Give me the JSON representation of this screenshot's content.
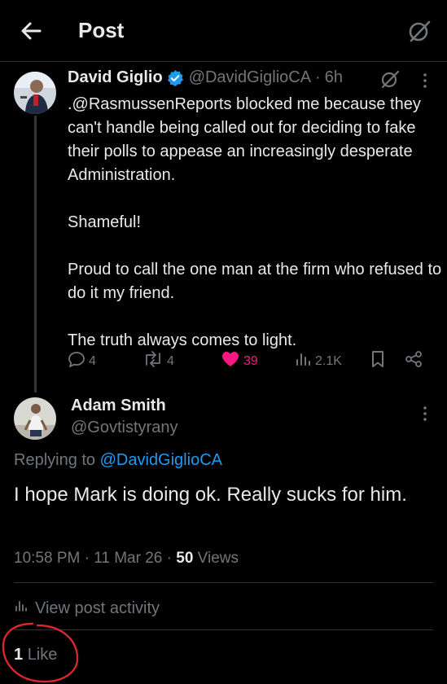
{
  "header": {
    "title": "Post"
  },
  "parent_post": {
    "author_name": "David Giglio",
    "handle": "@DavidGiglioCA",
    "separator": "·",
    "time": "6h",
    "paragraphs": [
      ".@RasmussenReports blocked me because they can't handle being called out for deciding to fake their polls to appease an increasingly desperate Administration.",
      "Shameful!",
      "Proud to call the one man at the firm who refused to do it my friend.",
      "The truth always comes to light."
    ],
    "actions": {
      "replies": "4",
      "reposts": "4",
      "likes": "39",
      "views": "2.1K"
    },
    "colors": {
      "like": "#f91880",
      "verified": "#1d9bf0"
    }
  },
  "reply": {
    "author_name": "Adam Smith",
    "handle": "@Govtistyrany",
    "replying_prefix": "Replying to",
    "replying_to": "@DavidGiglioCA",
    "text": "I hope Mark is doing ok. Really sucks for him.",
    "time": "10:58 PM",
    "sep1": "·",
    "date": "11 Mar 26",
    "sep2": "·",
    "views_count": "50",
    "views_label": "Views",
    "activity_label": "View post activity",
    "likes_count": "1",
    "likes_label": "Like"
  },
  "annotation": {
    "circle_color": "#d9262c"
  }
}
